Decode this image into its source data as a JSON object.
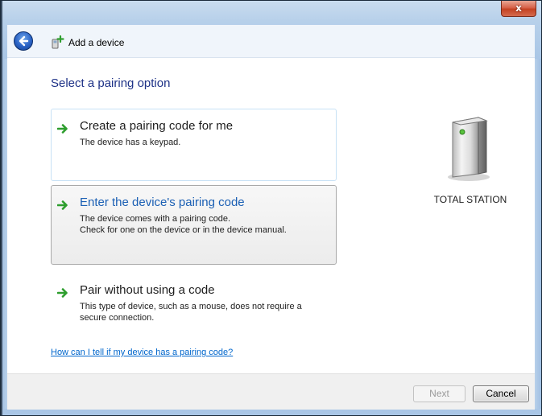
{
  "window": {
    "title": "Add a device",
    "close_label": "x"
  },
  "main": {
    "instruction": "Select a pairing option",
    "options": [
      {
        "title": "Create a pairing code for me",
        "description": "The device has a keypad."
      },
      {
        "title": "Enter the device's pairing code",
        "description_line1": "The device comes with a pairing code.",
        "description_line2": "Check for one on the device or in the device manual."
      },
      {
        "title": "Pair without using a code",
        "description_line1": "This type of device, such as a mouse, does not require a",
        "description_line2": "secure connection."
      }
    ],
    "help_link": "How can I tell if my device has a pairing code?"
  },
  "device": {
    "name": "TOTAL STATION",
    "icon": "device-tower-icon"
  },
  "footer": {
    "next_label": "Next",
    "cancel_label": "Cancel"
  },
  "icons": {
    "back": "back-arrow-icon",
    "add_device": "add-device-icon",
    "option_arrow": "green-arrow-icon"
  },
  "colors": {
    "instruction": "#1e3287",
    "selected_option_title": "#1a5fb4",
    "link": "#0066cc",
    "arrow_green": "#2e9e2e",
    "close_button": "#c44222"
  }
}
